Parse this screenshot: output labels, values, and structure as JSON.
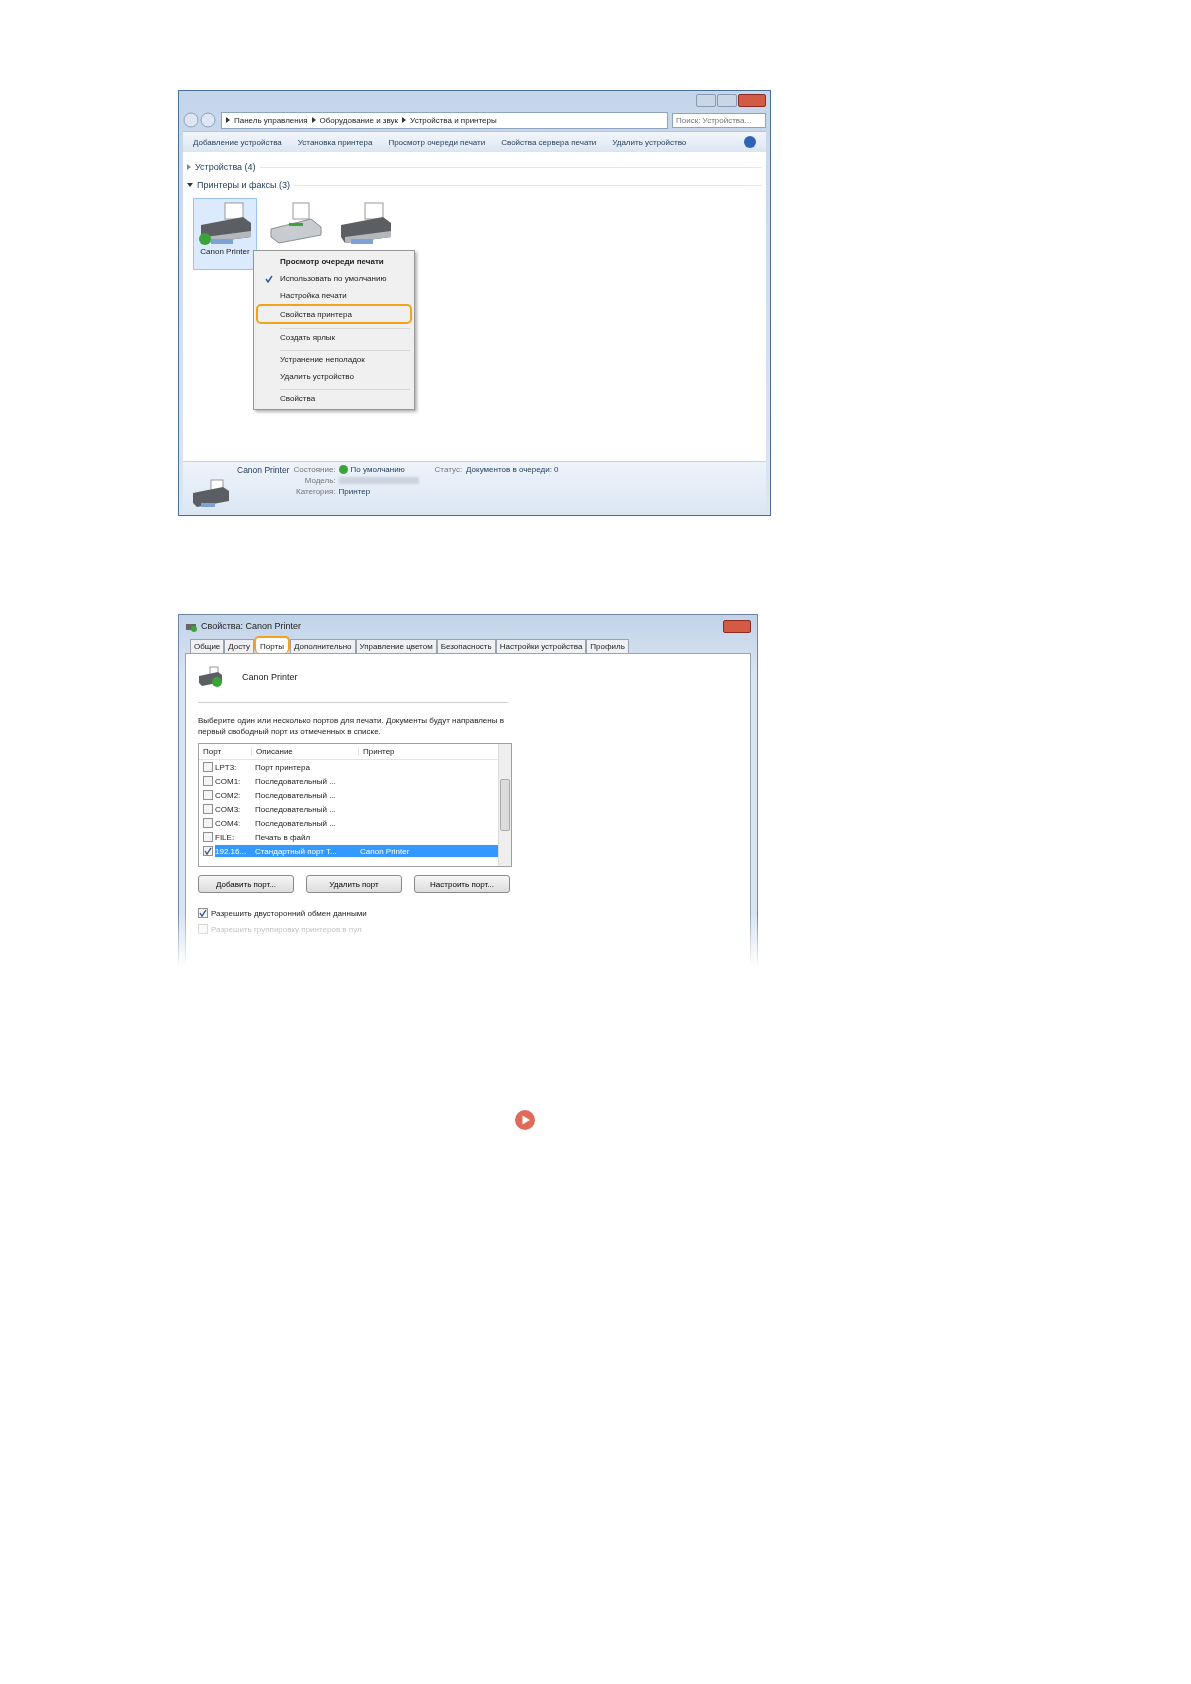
{
  "explorer": {
    "breadcrumb": [
      "Панель управления",
      "Оборудование и звук",
      "Устройства и принтеры"
    ],
    "search": {
      "placeholder": "Поиск: Устройства..."
    },
    "toolbar": [
      "Добавление устройства",
      "Установка принтера",
      "Просмотр очереди печати",
      "Свойства сервера печати",
      "Удалить устройство"
    ],
    "groups": [
      {
        "label": "Устройства (4)",
        "expanded": false
      },
      {
        "label": "Принтеры и факсы (3)",
        "expanded": true
      }
    ],
    "printers": [
      {
        "kind": "printer",
        "label": "Canon Printer",
        "selected": true,
        "default": true
      },
      {
        "kind": "fax",
        "selected": false,
        "default": false
      },
      {
        "kind": "printer",
        "selected": false,
        "default": false
      }
    ],
    "context_menu": [
      {
        "label": "Просмотр очереди печати",
        "bold": true,
        "checked": false,
        "highlighted": false,
        "separator_before": false
      },
      {
        "label": "Использовать по умолчанию",
        "bold": false,
        "checked": true,
        "highlighted": false,
        "separator_before": false
      },
      {
        "label": "Настройка печати",
        "bold": false,
        "checked": false,
        "highlighted": false,
        "separator_before": false
      },
      {
        "label": "Свойства принтера",
        "bold": false,
        "checked": false,
        "highlighted": true,
        "separator_before": false
      },
      {
        "label": "Создать ярлык",
        "bold": false,
        "checked": false,
        "highlighted": false,
        "separator_before": true
      },
      {
        "label": "Устранение неполадок",
        "bold": false,
        "checked": false,
        "highlighted": false,
        "separator_before": true
      },
      {
        "label": "Удалить устройство",
        "bold": false,
        "checked": false,
        "highlighted": false,
        "separator_before": false
      },
      {
        "label": "Свойства",
        "bold": false,
        "checked": false,
        "highlighted": false,
        "separator_before": true
      }
    ],
    "details": {
      "name": "Canon Printer",
      "state_label": "Состояние:",
      "state_value": "По умолчанию",
      "model_label": "Модель:",
      "category_label": "Категория:",
      "category_value": "Принтер",
      "status_label": "Статус:",
      "status_value": "Документов в очереди: 0"
    }
  },
  "properties": {
    "title": "Свойства: Canon Printer",
    "tabs": [
      {
        "label": "Общие",
        "selected": false
      },
      {
        "label": "Досту",
        "selected": false
      },
      {
        "label": "Порты",
        "selected": true
      },
      {
        "label": "Дополнительно",
        "selected": false
      },
      {
        "label": "Управление цветом",
        "selected": false
      },
      {
        "label": "Безопасность",
        "selected": false
      },
      {
        "label": "Настройки устройства",
        "selected": false
      },
      {
        "label": "Профиль",
        "selected": false
      }
    ],
    "printer_name": "Canon Printer",
    "description": "Выберите один или несколько портов для печати. Документы будут направлены в первый свободный порт из отмеченных в списке.",
    "columns": [
      "Порт",
      "Описание",
      "Принтер"
    ],
    "rows": [
      {
        "port": "LPT3:",
        "description": "Порт принтера",
        "checked": false,
        "selected": false
      },
      {
        "port": "COM1:",
        "description": "Последовательный ...",
        "checked": false,
        "selected": false
      },
      {
        "port": "COM2:",
        "description": "Последовательный ...",
        "checked": false,
        "selected": false
      },
      {
        "port": "COM3:",
        "description": "Последовательный ...",
        "checked": false,
        "selected": false
      },
      {
        "port": "COM4:",
        "description": "Последовательный ...",
        "checked": false,
        "selected": false
      },
      {
        "port": "FILE:",
        "description": "Печать в файл",
        "checked": false,
        "selected": false
      },
      {
        "port": "192.16...",
        "description": "Стандартный порт T...",
        "printer": "Canon Printer",
        "checked": true,
        "selected": true
      }
    ],
    "buttons": [
      "Добавить порт...",
      "Удалить порт",
      "Настроить порт..."
    ],
    "options": [
      {
        "label": "Разрешить двусторонний обмен данными",
        "checked": true,
        "disabled": false
      },
      {
        "label": "Разрешить группировку принтеров в пул",
        "checked": false,
        "disabled": true
      }
    ]
  }
}
